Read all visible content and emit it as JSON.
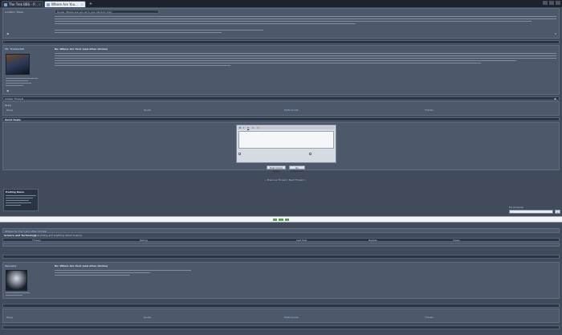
{
  "browser": {
    "tabs": [
      {
        "label": "The Trek BBS - P...",
        "active": false
      },
      {
        "label": "Where Are You...",
        "active": true
      }
    ],
    "new_tab_label": "+"
  },
  "top_pane": {
    "quote_box_title": "Quote: Where are you at in your fandom trip?",
    "post1_user": "Location: Texas",
    "post1_text_lines": 4,
    "post2_header": "Re: Where Are You? (and other stories)",
    "post2_user": "Mr. Trekkerbill",
    "post2_text_lines": 6,
    "reply_box_label": "Quick Reply",
    "bar_labels": [
      "Similar Threads",
      "Reply",
      "Quote",
      "Multi-Quote",
      "Thanks"
    ],
    "buttons": {
      "post_reply": "Post Quick Reply",
      "go_advanced": "Go Advanced"
    },
    "forum_jump_label": "« Previous Thread | Next Thread »",
    "jump_select": "Forum Jump",
    "sidebar_box_title": "Posting Rules"
  },
  "bottom_pane": {
    "breadcrumb": "Where Are You? (and other stories)",
    "section_title": "Science and Technology",
    "section_desc": "Everything and anything about science",
    "columns": [
      "Thread",
      "Rating",
      "Last Post",
      "Replies",
      "Views"
    ],
    "post_header": "Re: Where Are You? (and other stories)",
    "post_user": "Squeaky",
    "post_text_lines": 3,
    "bar_labels": [
      "Reply",
      "Quote",
      "Multi-Quote",
      "Thanks"
    ]
  }
}
